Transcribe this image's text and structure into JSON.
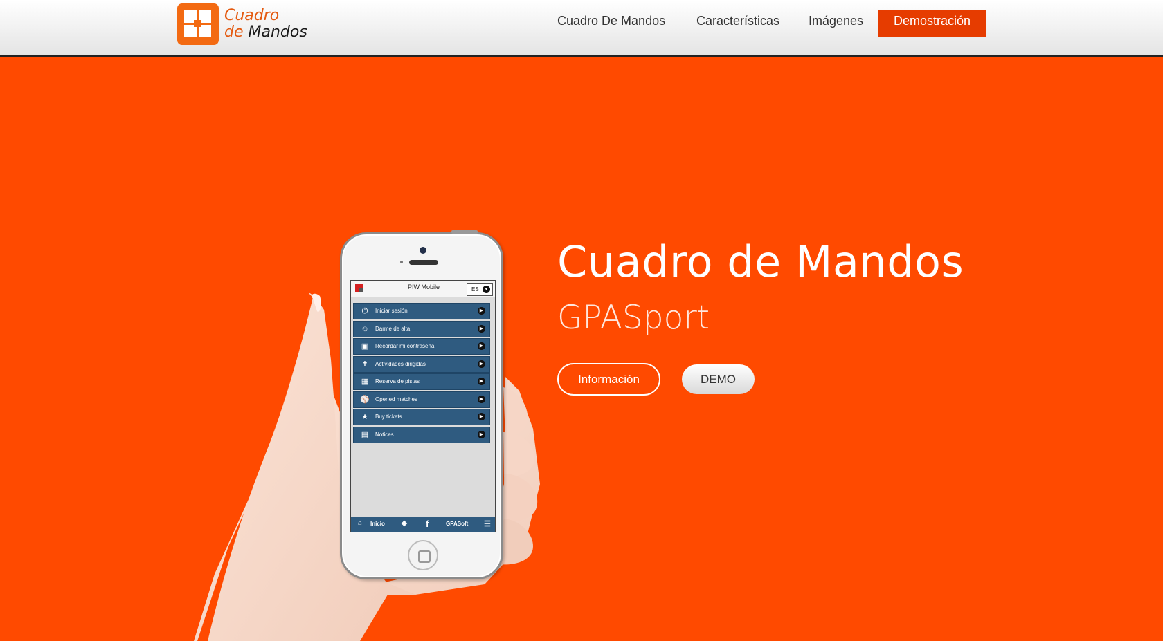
{
  "brand": {
    "line1": "Cuadro",
    "line2a": "de",
    "line2b": "Mandos",
    "accent_color": "#ff4a00",
    "logo_color": "#f36a12"
  },
  "nav": {
    "items": [
      {
        "label": "Cuadro De Mandos"
      },
      {
        "label": "Características"
      },
      {
        "label": "Imágenes"
      },
      {
        "label": "Demostración",
        "active": true
      }
    ]
  },
  "hero": {
    "title": "Cuadro de Mandos",
    "subtitle": "GPASport",
    "info_button": "Información",
    "demo_button": "DEMO"
  },
  "phone_screen": {
    "app_title": "PIW Mobile",
    "language": "ES",
    "menu": [
      {
        "label": "Iniciar sesión",
        "icon": "power-icon"
      },
      {
        "label": "Darme de alta",
        "icon": "user-add-icon"
      },
      {
        "label": "Recordar mi contraseña",
        "icon": "lock-icon"
      },
      {
        "label": "Actividades dirigidas",
        "icon": "activity-icon"
      },
      {
        "label": "Reserva de pistas",
        "icon": "calendar-icon"
      },
      {
        "label": "Opened matches",
        "icon": "matches-icon"
      },
      {
        "label": "Buy tickets",
        "icon": "ticket-icon"
      },
      {
        "label": "Notices",
        "icon": "notices-icon"
      }
    ],
    "footer": {
      "home": "Inicio",
      "brand": "GPASoft"
    }
  }
}
